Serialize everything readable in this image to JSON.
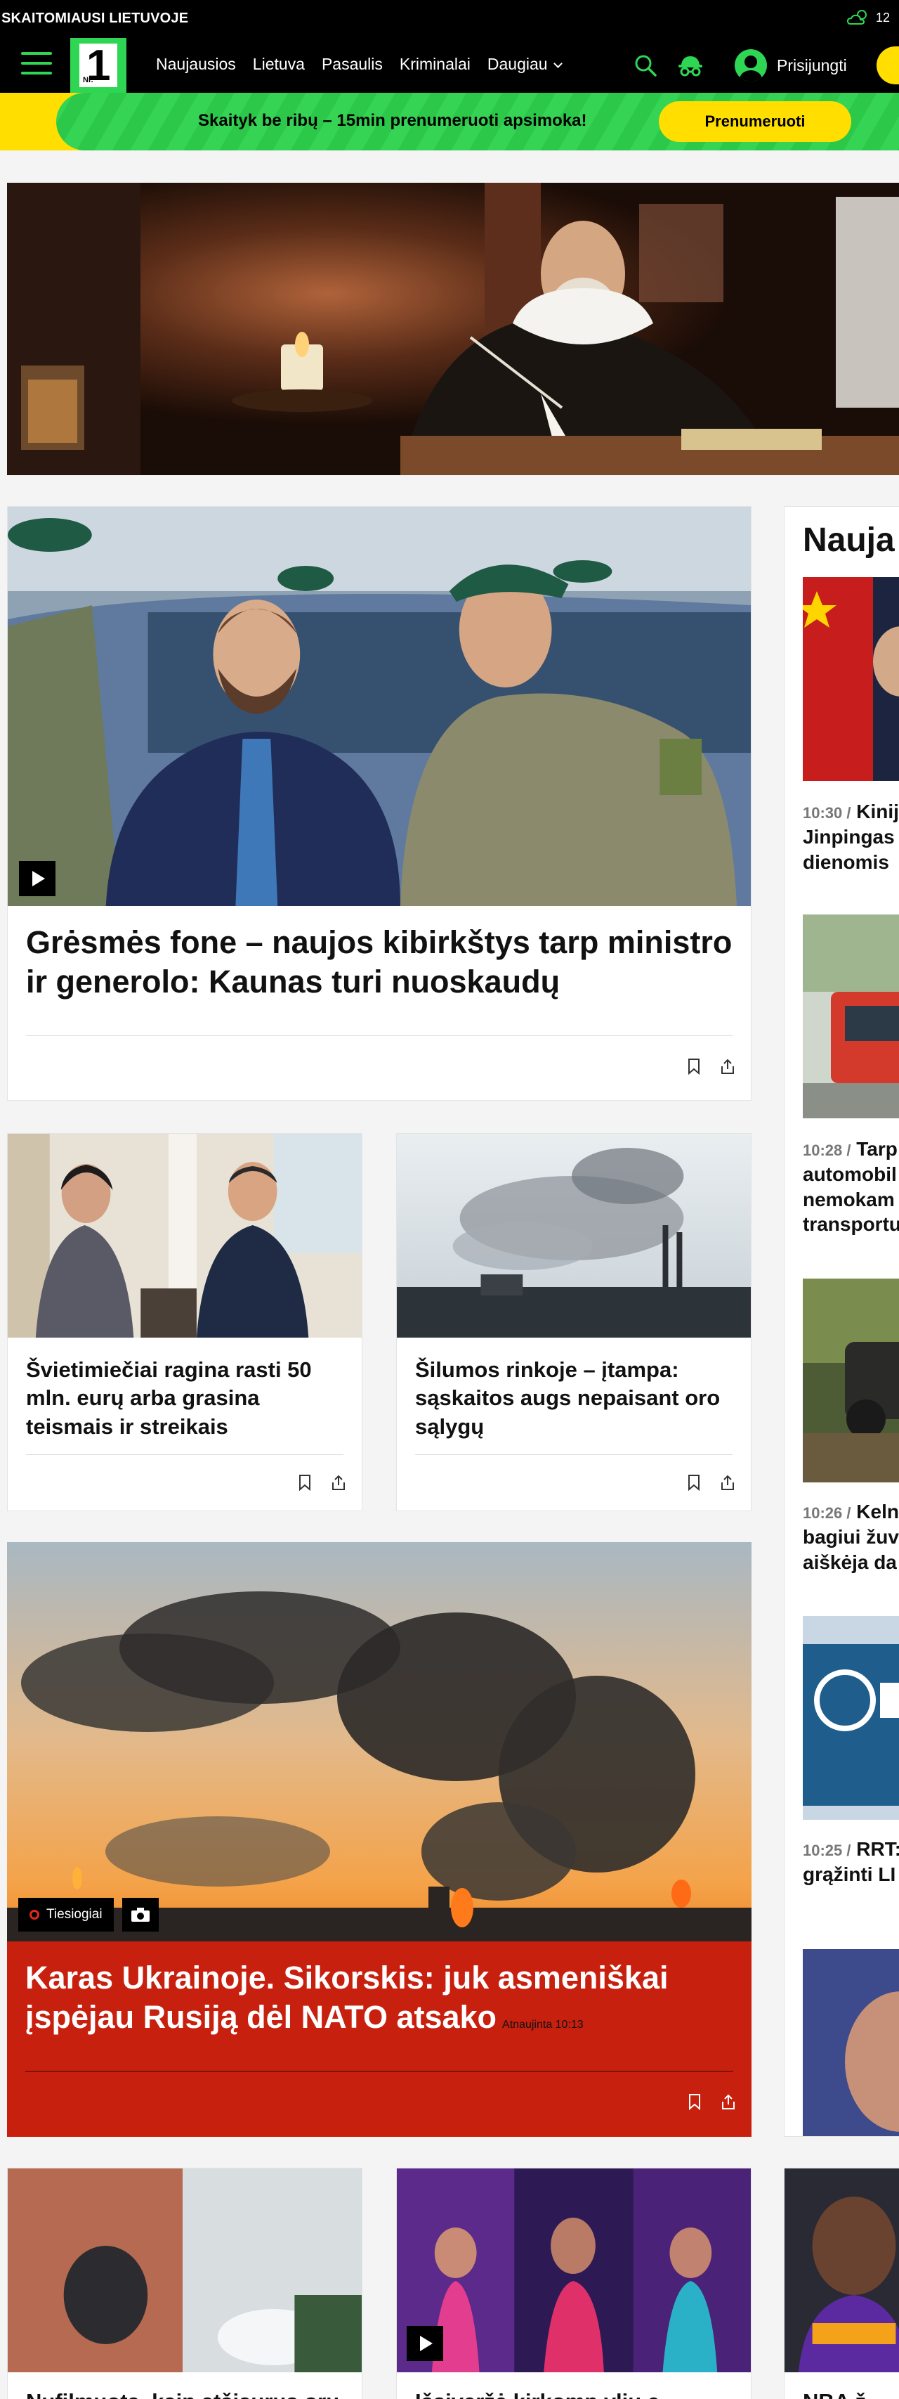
{
  "topbar": {
    "tagline": "SKAITOMIAUSI LIETUVOJE",
    "weather_temp": "12"
  },
  "nav": {
    "logo_number": "1",
    "logo_text": "Nr.",
    "links": [
      "Naujausios",
      "Lietuva",
      "Pasaulis",
      "Kriminalai",
      "Daugiau"
    ],
    "login_label": "Prisijungti"
  },
  "promo": {
    "text": "Skaityk be ribų – 15min prenumeruoti apsimoka!",
    "button_label": "Prenumeruoti"
  },
  "main_article": {
    "title": "Grėsmės fone – naujos kibirkštys tarp ministro ir generolo: Kaunas turi nuoskaudų"
  },
  "secondary_articles": [
    {
      "title": "Švietimiečiai ragina rasti 50 mln. eurų arba grasina teismais ir streikais"
    },
    {
      "title": "Šilumos rinkoje – įtampa: sąskaitos augs nepaisant oro sąlygų"
    }
  ],
  "live_article": {
    "badge": "Tiesiogiai",
    "title": "Karas Ukrainoje. Sikorskis: juk asmeniškai įspėjau Rusiją dėl NATO atsako",
    "updated": "Atnaujinta 10:13"
  },
  "sidebar": {
    "heading": "Nauja",
    "items": [
      {
        "time": "10:30 /",
        "lines": [
          "Kinij",
          "Jinpingas",
          "dienomis"
        ]
      },
      {
        "time": "10:28 /",
        "lines": [
          "Tarp",
          "automobil",
          "nemokam",
          "transportu"
        ]
      },
      {
        "time": "10:26 /",
        "lines": [
          "Keln",
          "bagiui žuv",
          "aiškėja da"
        ]
      },
      {
        "time": "10:25 /",
        "lines": [
          "RRT:",
          "grąžinti LI"
        ]
      }
    ]
  },
  "lower_row": [
    {
      "title": "Nufilmuota, kaip atšiaurus oru"
    },
    {
      "title": "Išsiveržė kirkomp ylių ę"
    },
    {
      "title": "NBA ž"
    }
  ],
  "colors": {
    "brand_green": "#2fd653",
    "brand_yellow": "#ffde00",
    "live_red": "#c8200e"
  }
}
